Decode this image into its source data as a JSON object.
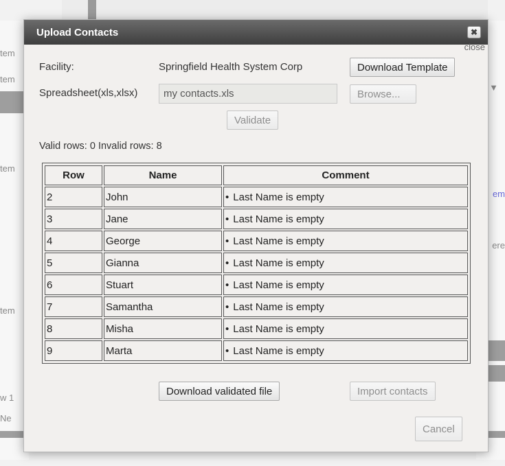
{
  "background": {
    "left_labels": [
      "tem",
      "tem",
      "tem",
      "tem"
    ],
    "right_fragments": [
      "close",
      "em",
      "ere"
    ],
    "bottom_left": [
      "w 1",
      "Ne"
    ]
  },
  "dialog": {
    "title": "Upload Contacts",
    "close_symbol": "✖",
    "close_label": "close",
    "facility_label": "Facility:",
    "facility_value": "Springfield Health System Corp",
    "download_template_label": "Download Template",
    "spreadsheet_label": "Spreadsheet(xls,xlsx)",
    "file_value": "my contacts.xls",
    "browse_label": "Browse...",
    "validate_label": "Validate",
    "summary": "Valid rows: 0 Invalid rows: 8",
    "table": {
      "headers": [
        "Row",
        "Name",
        "Comment"
      ],
      "rows": [
        {
          "row": "2",
          "name": "John",
          "comment": "Last Name is empty"
        },
        {
          "row": "3",
          "name": "Jane",
          "comment": "Last Name is empty"
        },
        {
          "row": "4",
          "name": "George",
          "comment": "Last Name is empty"
        },
        {
          "row": "5",
          "name": "Gianna",
          "comment": "Last Name is empty"
        },
        {
          "row": "6",
          "name": "Stuart",
          "comment": "Last Name is empty"
        },
        {
          "row": "7",
          "name": "Samantha",
          "comment": "Last Name is empty"
        },
        {
          "row": "8",
          "name": "Misha",
          "comment": "Last Name is empty"
        },
        {
          "row": "9",
          "name": "Marta",
          "comment": "Last Name is empty"
        }
      ]
    },
    "download_validated_label": "Download validated file",
    "import_label": "Import contacts",
    "cancel_label": "Cancel"
  },
  "colors": {
    "titlebar": "#4f4f4f",
    "dialog_bg": "#f2f0ee",
    "link": "#6a6ad8"
  }
}
